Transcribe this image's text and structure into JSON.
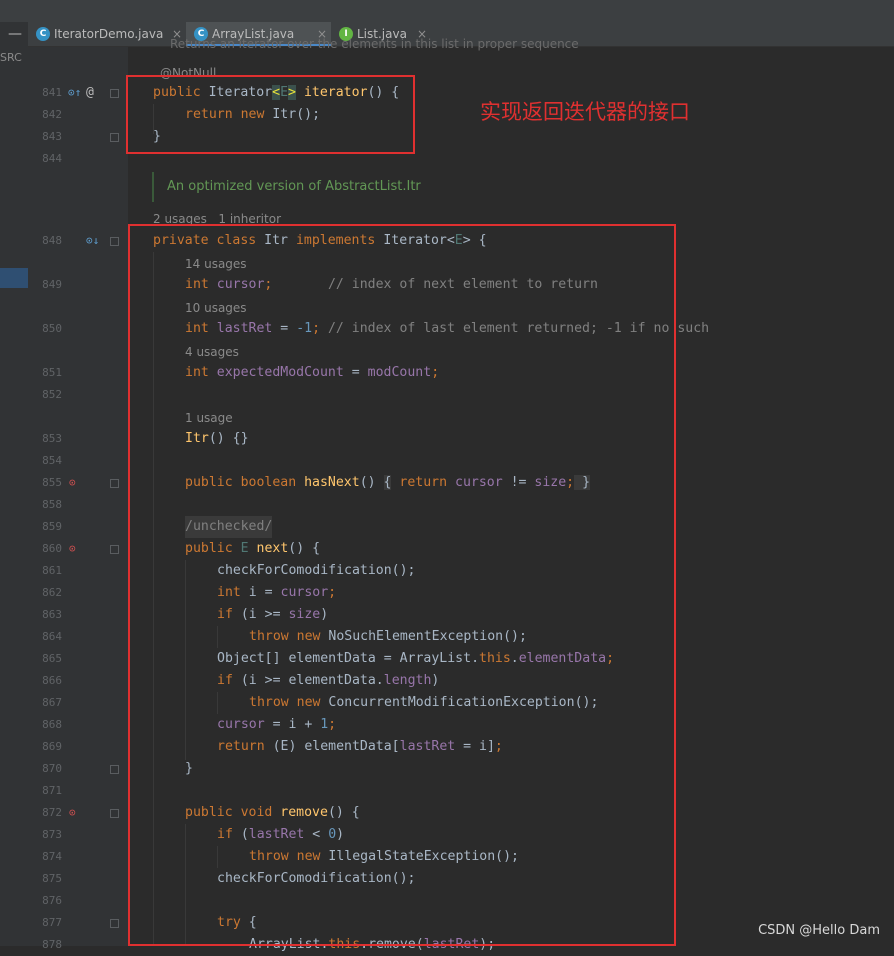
{
  "left_panel": {
    "collapse_symbol": "—",
    "label": "SRC"
  },
  "tabs": [
    {
      "label": "IteratorDemo.java",
      "close": "×",
      "icon": "class-icon",
      "color": "#3592c4"
    },
    {
      "label": "ArrayList.java",
      "close": "×",
      "icon": "class-icon",
      "color": "#3592c4",
      "active": true
    },
    {
      "label": "List.java",
      "close": "×",
      "icon": "interface-icon",
      "color": "#62b543"
    }
  ],
  "hints": {
    "doc_top": "Returns an iterator over the elements in this list in proper sequence",
    "notnull": "@NotNull",
    "doc_itr": "An optimized version of AbstractList.Itr",
    "itr_usages": "2 usages",
    "itr_inheritors": "1 inheritor",
    "cursor_usages": "14 usages",
    "lastret_usages": "10 usages",
    "expmod_usages": "4 usages",
    "ctor_usages": "1 usage",
    "unchecked": "/unchecked/"
  },
  "line_numbers": {
    "l841": "841",
    "l842": "842",
    "l843": "843",
    "l844": "844",
    "l848": "848",
    "l849": "849",
    "l850": "850",
    "l851": "851",
    "l852": "852",
    "l853": "853",
    "l854": "854",
    "l855": "855",
    "l858": "858",
    "l859": "859",
    "l860": "860",
    "l861": "861",
    "l862": "862",
    "l863": "863",
    "l864": "864",
    "l865": "865",
    "l866": "866",
    "l867": "867",
    "l868": "868",
    "l869": "869",
    "l870": "870",
    "l871": "871",
    "l872": "872",
    "l873": "873",
    "l874": "874",
    "l875": "875",
    "l876": "876",
    "l877": "877",
    "l878": "878"
  },
  "code": {
    "l841": {
      "kw": "public",
      "type": "Iterator",
      "lt": "<",
      "tp": "E",
      "gt": ">",
      "fn": "iterator",
      "rest": "() {"
    },
    "l842": {
      "kw": "return new",
      "type": "Itr",
      "rest": "();"
    },
    "l843": {
      "rest": "}"
    },
    "l848": {
      "kw": "private class",
      "type": "Itr",
      "kw2": "implements",
      "type2": "Iterator<",
      "tp": "E",
      "rest": "> {"
    },
    "l849": {
      "kw": "int",
      "fld": "cursor",
      "semi": ";",
      "comment": "// index of next element to return"
    },
    "l850": {
      "kw": "int",
      "fld": "lastRet",
      "eq": " = ",
      "num": "-1",
      "semi": ";",
      "comment": "// index of last element returned; -1 if no such"
    },
    "l851": {
      "kw": "int",
      "fld": "expectedModCount",
      "eq": " = ",
      "fld2": "modCount",
      "semi": ";"
    },
    "l853": {
      "fn": "Itr",
      "rest": "() {}"
    },
    "l855": {
      "kw": "public boolean",
      "fn": "hasNext",
      "rest": "() ",
      "brace": "{",
      "kw2": " return ",
      "fld": "cursor",
      "op": " != ",
      "fld2": "size",
      "semi": ";",
      "brace2": " }"
    },
    "l860": {
      "kw": "public",
      "tp": "E",
      "fn": "next",
      "rest": "() {"
    },
    "l861": {
      "call": "checkForComodification",
      "rest": "();"
    },
    "l862": {
      "kw": "int",
      "var": " i = ",
      "fld": "cursor",
      "semi": ";"
    },
    "l863": {
      "kw": "if",
      "rest": " (i >= ",
      "fld": "size",
      "rest2": ")"
    },
    "l864": {
      "kw": "throw new",
      "type": "NoSuchElementException",
      "rest": "();"
    },
    "l865": {
      "type": "Object[] elementData = ArrayList.",
      "kw": "this",
      "dot": ".",
      "fld": "elementData",
      "semi": ";"
    },
    "l866": {
      "kw": "if",
      "rest": " (i >= elementData.",
      "fld": "length",
      "rest2": ")"
    },
    "l867": {
      "kw": "throw new",
      "type": "ConcurrentModificationException",
      "rest": "();"
    },
    "l868": {
      "fld": "cursor",
      "rest": " = i + ",
      "num": "1",
      "semi": ";"
    },
    "l869": {
      "kw": "return",
      "rest": " (E) elementData[",
      "fld": "lastRet",
      "rest2": " = i]",
      "semi": ";"
    },
    "l870": {
      "rest": "}"
    },
    "l872": {
      "kw": "public void",
      "fn": "remove",
      "rest": "() {"
    },
    "l873": {
      "kw": "if",
      "rest": " (",
      "fld": "lastRet",
      "rest2": " < ",
      "num": "0",
      "rest3": ")"
    },
    "l874": {
      "kw": "throw new",
      "type": "IllegalStateException",
      "rest": "();"
    },
    "l875": {
      "call": "checkForComodification",
      "rest": "();"
    },
    "l877": {
      "kw": "try",
      "rest": " {"
    },
    "l878": {
      "type": "ArrayList.",
      "kw": "this",
      "rest": ".remove(",
      "fld": "lastRet",
      "rest2": ");"
    }
  },
  "annotation": {
    "callout": "实现返回迭代器的接口",
    "color": "#e03030"
  },
  "watermark": "CSDN @Hello Dam",
  "colors": {
    "keyword": "#cc7832",
    "method": "#ffc66d",
    "field": "#9876aa",
    "number": "#6897bb",
    "comment": "#808080",
    "doc": "#629755",
    "text": "#a9b7c6",
    "background": "#2b2b2b",
    "gutter": "#313335"
  }
}
